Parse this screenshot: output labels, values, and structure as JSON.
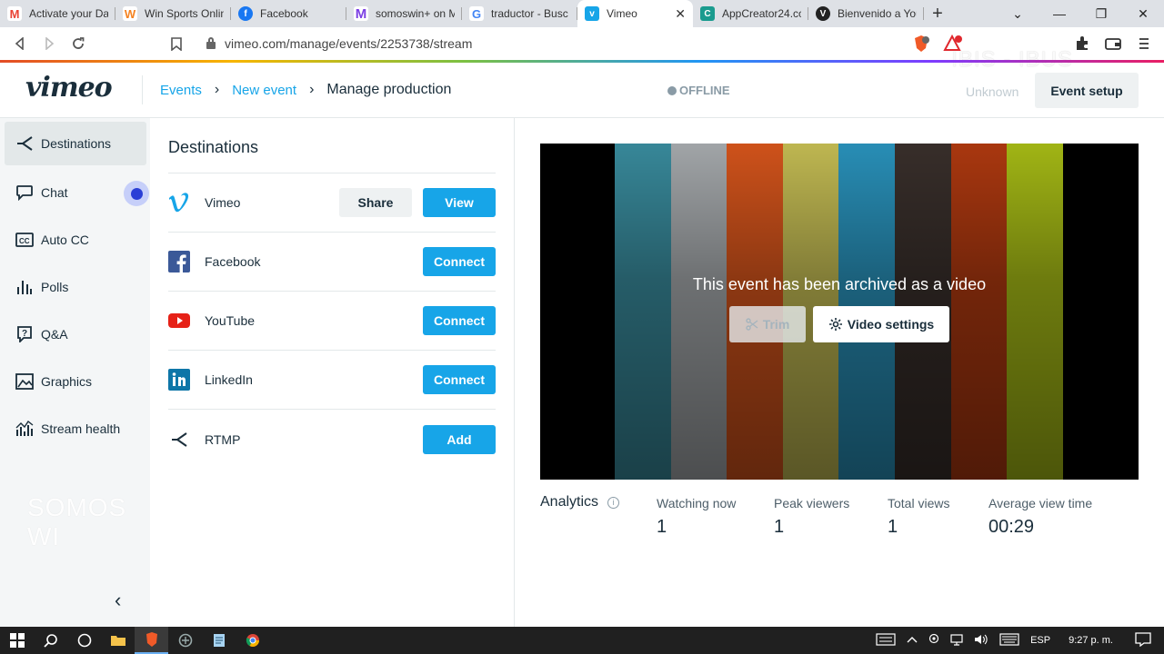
{
  "browser": {
    "tabs": [
      {
        "label": "Activate your Da",
        "icon": "gmail-icon",
        "color": "#ea4335",
        "glyph": "M"
      },
      {
        "label": "Win Sports Onlin",
        "icon": "winsports-icon",
        "color": "#f58220",
        "glyph": "W"
      },
      {
        "label": "Facebook",
        "icon": "facebook-icon",
        "color": "#1877f2",
        "glyph": "f"
      },
      {
        "label": "somoswin+ on M",
        "icon": "somoswin-icon",
        "color": "#7b3fe4",
        "glyph": "M"
      },
      {
        "label": "traductor - Busc",
        "icon": "google-icon",
        "color": "#4285f4",
        "glyph": "G"
      },
      {
        "label": "Vimeo",
        "icon": "vimeo-icon",
        "color": "#17a5e8",
        "glyph": "v",
        "active": true
      },
      {
        "label": "AppCreator24.cc",
        "icon": "appcreator-icon",
        "color": "#1a9b8e",
        "glyph": "C"
      },
      {
        "label": "Bienvenido a You",
        "icon": "bienvenido-icon",
        "color": "#222222",
        "glyph": "V"
      }
    ],
    "url": "vimeo.com/manage/events/2253738/stream",
    "watermark": "IBIS - IBUS"
  },
  "header": {
    "logo": "vimeo",
    "breadcrumb": [
      "Events",
      "New event",
      "Manage production"
    ],
    "status": "OFFLINE",
    "unknown": "Unknown",
    "event_setup": "Event setup"
  },
  "sidebar": {
    "items": [
      {
        "label": "Destinations",
        "active": true
      },
      {
        "label": "Chat"
      },
      {
        "label": "Auto CC"
      },
      {
        "label": "Polls"
      },
      {
        "label": "Q&A"
      },
      {
        "label": "Graphics"
      },
      {
        "label": "Stream health"
      }
    ],
    "watermark": "SOMOS WI"
  },
  "destinations": {
    "title": "Destinations",
    "rows": [
      {
        "name": "Vimeo",
        "secondary": "Share",
        "primary": "View"
      },
      {
        "name": "Facebook",
        "primary": "Connect"
      },
      {
        "name": "YouTube",
        "primary": "Connect"
      },
      {
        "name": "LinkedIn",
        "primary": "Connect"
      },
      {
        "name": "RTMP",
        "primary": "Add"
      }
    ]
  },
  "player": {
    "message": "This event has been archived as a video",
    "trim": "Trim",
    "video_settings": "Video settings",
    "bar_colors": [
      "#3a8ea0",
      "#a9adb0",
      "#d9561c",
      "#c8c055",
      "#2a95bf",
      "#3a302c",
      "#b23a10",
      "#a9be16"
    ]
  },
  "analytics": {
    "title": "Analytics",
    "stats": [
      {
        "label": "Watching now",
        "value": "1"
      },
      {
        "label": "Peak viewers",
        "value": "1"
      },
      {
        "label": "Total views",
        "value": "1"
      },
      {
        "label": "Average view time",
        "value": "00:29"
      }
    ]
  },
  "taskbar": {
    "language": "ESP",
    "time": "9:27 p. m."
  }
}
